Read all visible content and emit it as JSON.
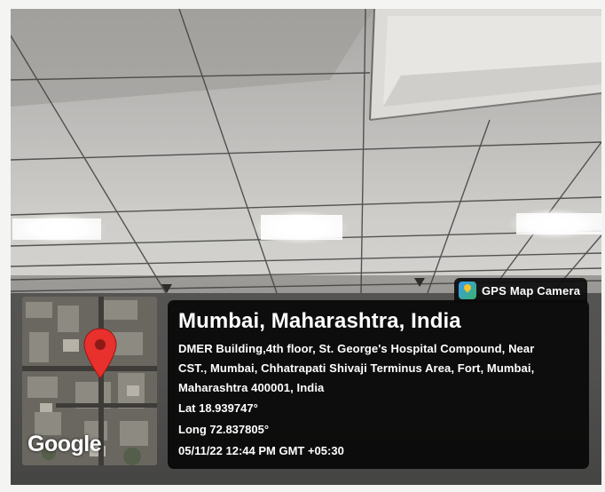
{
  "badge": {
    "app_name": "GPS Map Camera",
    "icon": "gps-map-camera-app-icon"
  },
  "map": {
    "logo_text": "Google",
    "pin_icon": "map-pin-icon",
    "pin_color": "#e8302c"
  },
  "location": {
    "title": "Mumbai, Maharashtra, India",
    "address_lines": [
      "DMER Building,4th floor, St. George's Hospital Compound, Near",
      "CST., Mumbai, Chhatrapati Shivaji Terminus Area, Fort, Mumbai,",
      "Maharashtra 400001, India"
    ],
    "lat": "Lat 18.939747°",
    "long": "Long 72.837805°",
    "timestamp": "05/11/22 12:44 PM GMT +05:30"
  }
}
